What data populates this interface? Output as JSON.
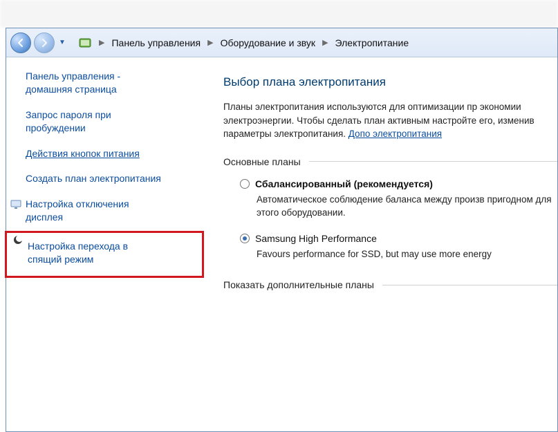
{
  "breadcrumb": {
    "items": [
      "Панель управления",
      "Оборудование и звук",
      "Электропитание"
    ]
  },
  "sidebar": {
    "home1": "Панель управления -",
    "home2": "домашняя страница",
    "wake1": "Запрос пароля при",
    "wake2": "пробуждении",
    "pwrbtn": "Действия кнопок питания",
    "createplan": "Создать план электропитания",
    "displayoff1": "Настройка отключения",
    "displayoff2": "дисплея",
    "sleep1": "Настройка перехода в",
    "sleep2": "спящий режим"
  },
  "main": {
    "title": "Выбор плана электропитания",
    "intro": "Планы электропитания используются для оптимизации пр экономии электроэнергии. Чтобы сделать план активным настройте его, изменив параметры электропитания. ",
    "intro_link": "Допо электропитания",
    "group_main": "Основные планы",
    "plan1_name": "Сбалансированный (рекомендуется)",
    "plan1_desc": "Автоматическое соблюдение баланса между произв пригодном для этого оборудовании.",
    "plan2_name": "Samsung High Performance",
    "plan2_desc": "Favours performance for SSD, but may use more energy",
    "showmore": "Показать дополнительные планы"
  }
}
